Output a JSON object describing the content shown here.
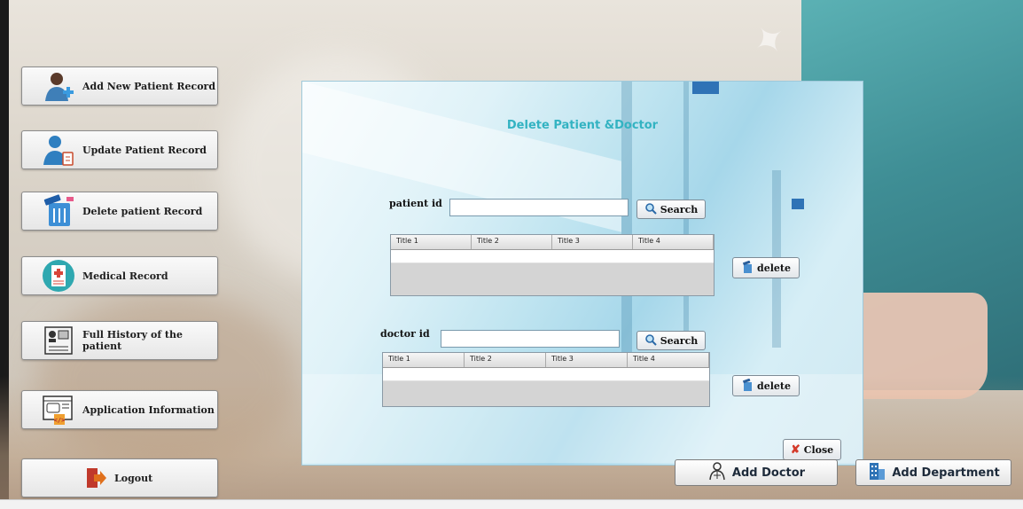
{
  "nav": {
    "add_patient": "Add New Patient Record",
    "update_patient": "Update Patient Record",
    "delete_patient": "Delete patient Record",
    "medical_record": "Medical Record",
    "full_history": "Full History of the patient",
    "app_info": "Application Information",
    "logout": "Logout"
  },
  "dialog": {
    "title": "Delete Patient &Doctor",
    "patient": {
      "label": "patient id",
      "value": "",
      "search_label": "Search",
      "delete_label": "delete",
      "columns": [
        "Title 1",
        "Title 2",
        "Title 3",
        "Title 4"
      ]
    },
    "doctor": {
      "label": "doctor id",
      "value": "",
      "search_label": "Search",
      "delete_label": "delete",
      "columns": [
        "Title 1",
        "Title 2",
        "Title 3",
        "Title 4"
      ]
    },
    "close_label": "Close"
  },
  "bottom": {
    "add_doctor": "Add Doctor",
    "add_department": "Add Department"
  },
  "colors": {
    "title_accent": "#33b3c2",
    "close_icon": "#d43a2a"
  }
}
